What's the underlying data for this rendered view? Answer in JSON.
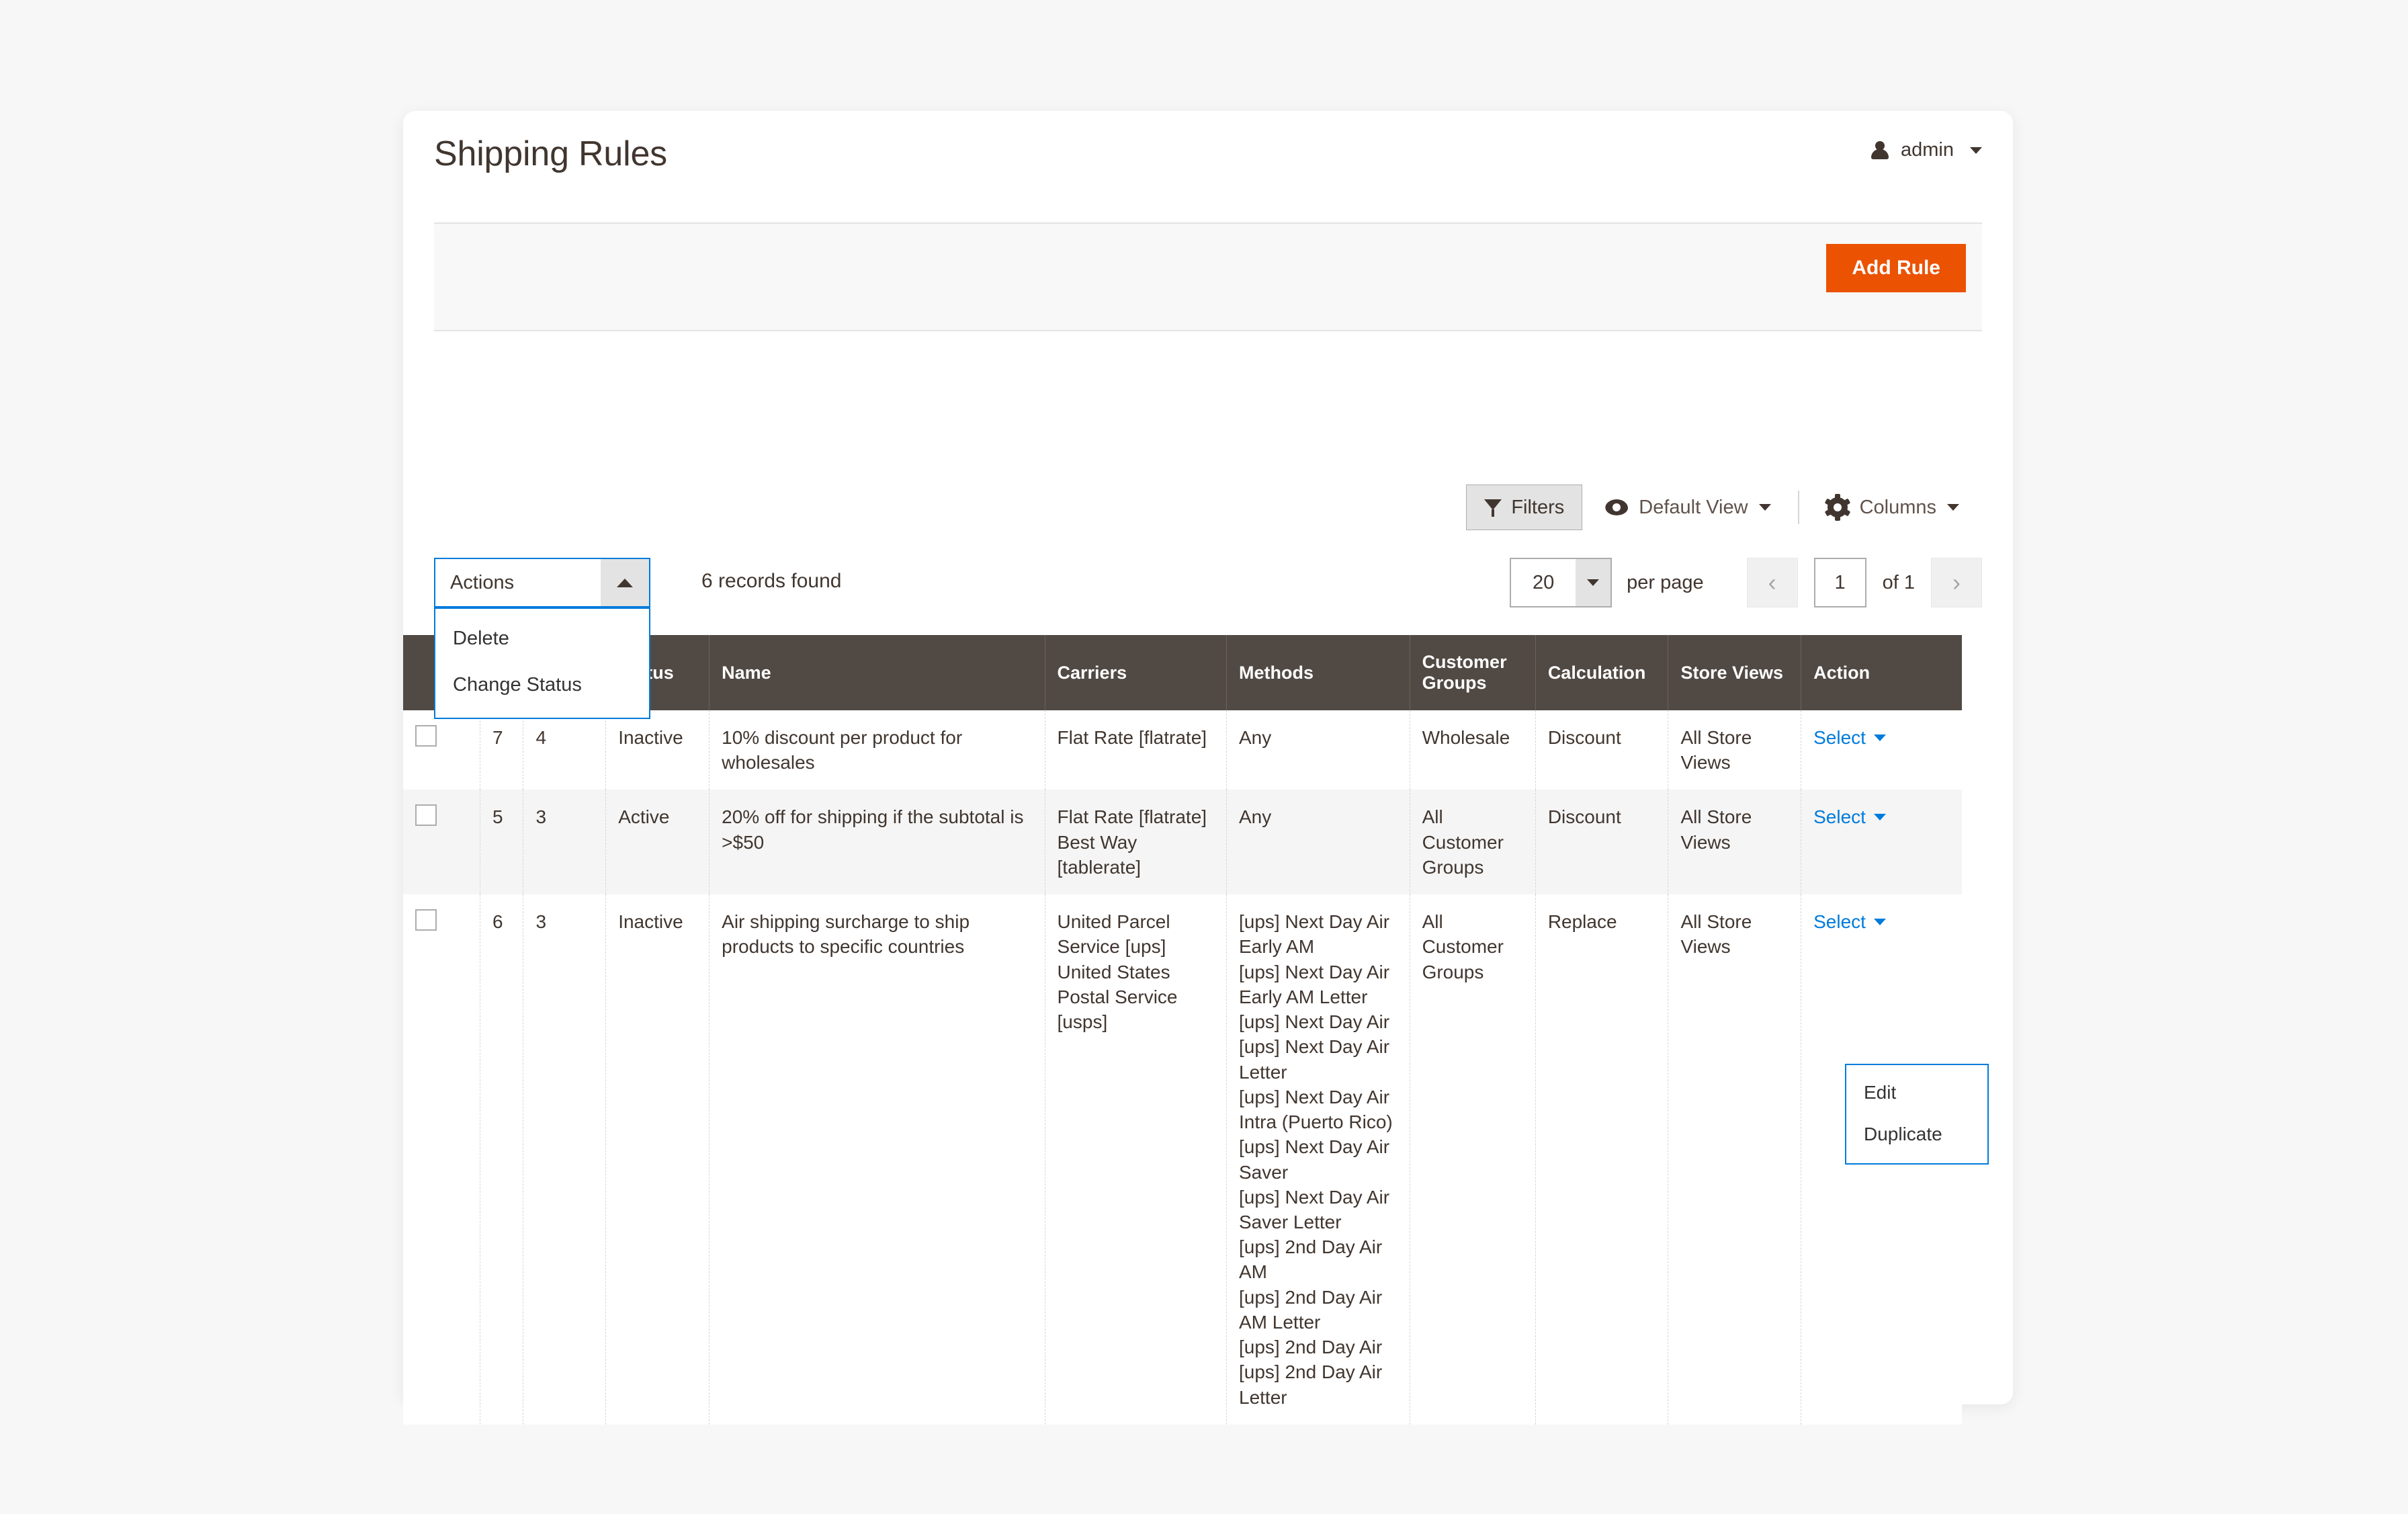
{
  "header": {
    "title": "Shipping Rules",
    "admin_label": "admin",
    "admin_icon": "user-icon",
    "admin_caret_icon": "chevron-down-icon"
  },
  "action_bar": {
    "add_rule_label": "Add Rule"
  },
  "grid_toolbar": {
    "filters_label": "Filters",
    "filters_icon": "funnel-icon",
    "view_label": "Default View",
    "view_icon": "eye-icon",
    "view_caret_icon": "chevron-down-icon",
    "columns_label": "Columns",
    "columns_icon": "gear-icon",
    "columns_caret_icon": "chevron-down-icon"
  },
  "grid_controls": {
    "actions_label": "Actions",
    "actions_arrow_icon": "chevron-up-icon",
    "actions_menu": [
      {
        "label": "Delete"
      },
      {
        "label": "Change Status"
      }
    ],
    "records_found": "6 records found",
    "per_page_value": "20",
    "per_page_arrow_icon": "chevron-down-icon",
    "per_page_label": "per page",
    "prev_icon": "chevron-left-icon",
    "next_icon": "chevron-right-icon",
    "page_value": "1",
    "page_of": "of 1"
  },
  "table": {
    "columns": [
      {
        "key": "checkbox",
        "label": ""
      },
      {
        "key": "id",
        "label": ""
      },
      {
        "key": "priority",
        "label": "",
        "sort_icon": "sort-asc-icon"
      },
      {
        "key": "status",
        "label": "Status"
      },
      {
        "key": "name",
        "label": "Name"
      },
      {
        "key": "carriers",
        "label": "Carriers"
      },
      {
        "key": "methods",
        "label": "Methods"
      },
      {
        "key": "customer_groups",
        "label": "Customer Groups"
      },
      {
        "key": "calculation",
        "label": "Calculation"
      },
      {
        "key": "store_views",
        "label": "Store Views"
      },
      {
        "key": "action",
        "label": "Action"
      }
    ],
    "action_link_label": "Select",
    "action_caret_icon": "chevron-down-icon",
    "rows": [
      {
        "id": "7",
        "priority": "4",
        "status": "Inactive",
        "name": "10% discount per product for wholesales",
        "carriers": [
          "Flat Rate [flatrate]"
        ],
        "methods": [
          "Any"
        ],
        "customer_groups": "Wholesale",
        "calculation": "Discount",
        "store_views": "All Store Views",
        "action": "Select"
      },
      {
        "id": "5",
        "priority": "3",
        "status": "Active",
        "name": "20% off for shipping if the subtotal is >$50",
        "carriers": [
          "Flat Rate [flatrate]",
          "Best Way [tablerate]"
        ],
        "methods": [
          "Any"
        ],
        "customer_groups": "All Customer Groups",
        "calculation": "Discount",
        "store_views": "All Store Views",
        "action": "Select"
      },
      {
        "id": "6",
        "priority": "3",
        "status": "Inactive",
        "name": "Air shipping surcharge to ship products to specific countries",
        "carriers": [
          "United Parcel Service [ups]",
          "United States Postal Service [usps]"
        ],
        "methods": [
          "[ups] Next Day Air Early AM",
          "[ups] Next Day Air Early AM Letter",
          "[ups] Next Day Air",
          "[ups] Next Day Air Letter",
          "[ups] Next Day Air Intra (Puerto Rico)",
          "[ups] Next Day Air Saver",
          "[ups] Next Day Air Saver Letter",
          "[ups] 2nd Day Air AM",
          "[ups] 2nd Day Air AM Letter",
          "[ups] 2nd Day Air",
          "[ups] 2nd Day Air Letter"
        ],
        "customer_groups": "All Customer Groups",
        "calculation": "Replace",
        "store_views": "All Store Views",
        "action": "Select"
      }
    ],
    "row_action_menu": [
      {
        "label": "Edit"
      },
      {
        "label": "Duplicate"
      }
    ]
  },
  "colors": {
    "accent": "#eb5202",
    "link": "#007bdb",
    "header_row": "#514943",
    "text": "#41362f"
  }
}
